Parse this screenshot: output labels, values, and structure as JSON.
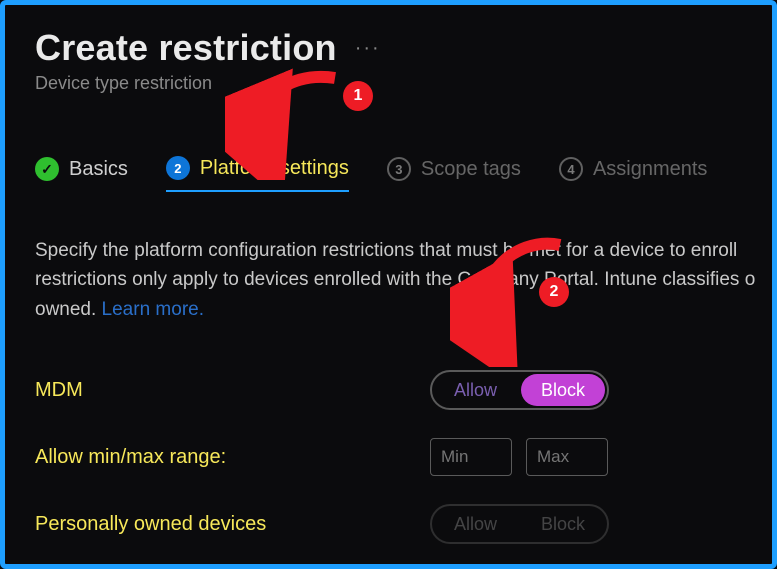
{
  "header": {
    "title": "Create restriction",
    "subtitle": "Device type restriction",
    "ellipsis": "···"
  },
  "steps": {
    "done": {
      "label": "Basics"
    },
    "active": {
      "num": "2",
      "label": "Platform settings"
    },
    "pending3": {
      "num": "3",
      "label": "Scope tags"
    },
    "pending4": {
      "num": "4",
      "label": "Assignments"
    }
  },
  "desc": {
    "line1": "Specify the platform configuration restrictions that must be met for a device to enroll",
    "line2a": "restrictions only apply to devices enrolled with the C",
    "line2b": "pany Portal. Intune classifies o",
    "line3a": "owned. ",
    "learn": "Learn more."
  },
  "rows": {
    "mdm": {
      "label": "MDM",
      "allow": "Allow",
      "block": "Block"
    },
    "range": {
      "label": "Allow min/max range:",
      "min_ph": "Min",
      "max_ph": "Max"
    },
    "pod": {
      "label": "Personally owned devices",
      "allow": "Allow",
      "block": "Block"
    }
  },
  "annotations": {
    "one": "1",
    "two": "2"
  }
}
